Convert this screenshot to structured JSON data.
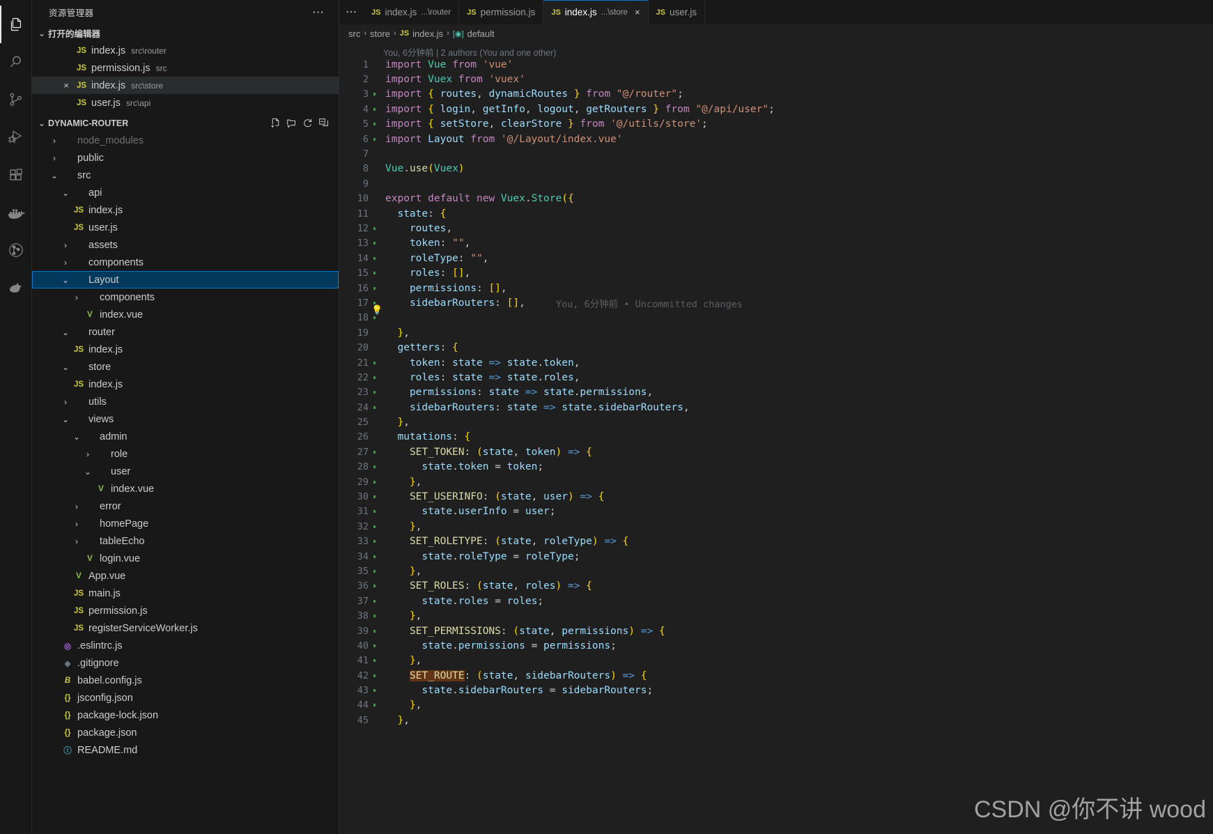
{
  "activity_bar": {
    "items": [
      {
        "name": "explorer",
        "icon": "files-icon",
        "active": true
      },
      {
        "name": "search",
        "icon": "search-icon",
        "active": false
      },
      {
        "name": "source-control",
        "icon": "source-control-icon",
        "active": false
      },
      {
        "name": "run-and-debug",
        "icon": "run-debug-icon",
        "active": false
      },
      {
        "name": "extensions",
        "icon": "extensions-icon",
        "active": false
      },
      {
        "name": "docker",
        "icon": "docker-icon",
        "active": false
      },
      {
        "name": "gitlens",
        "icon": "gitlens-icon",
        "active": false
      },
      {
        "name": "todo-tree",
        "icon": "todo-tree-icon",
        "active": false
      }
    ]
  },
  "sidebar": {
    "title": "资源管理器",
    "more_label": "⋯",
    "open_editors": {
      "label": "打开的编辑器",
      "twisty": "⌄",
      "items": [
        {
          "icon": "js-file-icon",
          "icon_text": "JS",
          "name": "index.js",
          "desc": "src\\router",
          "active": false,
          "close": ""
        },
        {
          "icon": "js-file-icon",
          "icon_text": "JS",
          "name": "permission.js",
          "desc": "src",
          "active": false,
          "close": ""
        },
        {
          "icon": "js-file-icon",
          "icon_text": "JS",
          "name": "index.js",
          "desc": "src\\store",
          "active": true,
          "close": "×"
        },
        {
          "icon": "js-file-icon",
          "icon_text": "JS",
          "name": "user.js",
          "desc": "src\\api",
          "active": false,
          "close": ""
        }
      ]
    },
    "project": {
      "label": "DYNAMIC-ROUTER",
      "twisty": "⌄",
      "actions": [
        "new-file-icon",
        "new-folder-icon",
        "refresh-icon",
        "collapse-all-icon"
      ],
      "tree": [
        {
          "indent": 1,
          "twisty": "›",
          "kind": "folder",
          "name": "node_modules",
          "dim": true
        },
        {
          "indent": 1,
          "twisty": "›",
          "kind": "folder",
          "name": "public",
          "dim": false
        },
        {
          "indent": 1,
          "twisty": "⌄",
          "kind": "folder",
          "name": "src",
          "dim": false
        },
        {
          "indent": 2,
          "twisty": "⌄",
          "kind": "folder",
          "name": "api",
          "dim": false
        },
        {
          "indent": 2,
          "twisty": "",
          "kind": "js",
          "icon_text": "JS",
          "name": "index.js",
          "dim": false
        },
        {
          "indent": 2,
          "twisty": "",
          "kind": "js",
          "icon_text": "JS",
          "name": "user.js",
          "dim": false
        },
        {
          "indent": 2,
          "twisty": "›",
          "kind": "folder",
          "name": "assets",
          "dim": false
        },
        {
          "indent": 2,
          "twisty": "›",
          "kind": "folder",
          "name": "components",
          "dim": false
        },
        {
          "indent": 2,
          "twisty": "⌄",
          "kind": "folder",
          "name": "Layout",
          "dim": false,
          "selected": true
        },
        {
          "indent": 3,
          "twisty": "›",
          "kind": "folder",
          "name": "components",
          "dim": false
        },
        {
          "indent": 3,
          "twisty": "",
          "kind": "vue",
          "icon_text": "V",
          "name": "index.vue",
          "dim": false
        },
        {
          "indent": 2,
          "twisty": "⌄",
          "kind": "folder",
          "name": "router",
          "dim": false
        },
        {
          "indent": 2,
          "twisty": "",
          "kind": "js",
          "icon_text": "JS",
          "name": "index.js",
          "dim": false
        },
        {
          "indent": 2,
          "twisty": "⌄",
          "kind": "folder",
          "name": "store",
          "dim": false
        },
        {
          "indent": 2,
          "twisty": "",
          "kind": "js",
          "icon_text": "JS",
          "name": "index.js",
          "dim": false
        },
        {
          "indent": 2,
          "twisty": "›",
          "kind": "folder",
          "name": "utils",
          "dim": false
        },
        {
          "indent": 2,
          "twisty": "⌄",
          "kind": "folder",
          "name": "views",
          "dim": false
        },
        {
          "indent": 3,
          "twisty": "⌄",
          "kind": "folder",
          "name": "admin",
          "dim": false
        },
        {
          "indent": 4,
          "twisty": "›",
          "kind": "folder",
          "name": "role",
          "dim": false
        },
        {
          "indent": 4,
          "twisty": "⌄",
          "kind": "folder",
          "name": "user",
          "dim": false
        },
        {
          "indent": 4,
          "twisty": "",
          "kind": "vue",
          "icon_text": "V",
          "name": "index.vue",
          "dim": false
        },
        {
          "indent": 3,
          "twisty": "›",
          "kind": "folder",
          "name": "error",
          "dim": false
        },
        {
          "indent": 3,
          "twisty": "›",
          "kind": "folder",
          "name": "homePage",
          "dim": false
        },
        {
          "indent": 3,
          "twisty": "›",
          "kind": "folder",
          "name": "tableEcho",
          "dim": false
        },
        {
          "indent": 3,
          "twisty": "",
          "kind": "vue",
          "icon_text": "V",
          "name": "login.vue",
          "dim": false
        },
        {
          "indent": 2,
          "twisty": "",
          "kind": "vue",
          "icon_text": "V",
          "name": "App.vue",
          "dim": false
        },
        {
          "indent": 2,
          "twisty": "",
          "kind": "js",
          "icon_text": "JS",
          "name": "main.js",
          "dim": false
        },
        {
          "indent": 2,
          "twisty": "",
          "kind": "js",
          "icon_text": "JS",
          "name": "permission.js",
          "dim": false
        },
        {
          "indent": 2,
          "twisty": "",
          "kind": "js",
          "icon_text": "JS",
          "name": "registerServiceWorker.js",
          "dim": false
        },
        {
          "indent": 1,
          "twisty": "",
          "kind": "eslint",
          "icon_text": "◎",
          "name": ".eslintrc.js",
          "dim": false
        },
        {
          "indent": 1,
          "twisty": "",
          "kind": "git",
          "icon_text": "◈",
          "name": ".gitignore",
          "dim": false
        },
        {
          "indent": 1,
          "twisty": "",
          "kind": "babel",
          "icon_text": "B",
          "name": "babel.config.js",
          "dim": false
        },
        {
          "indent": 1,
          "twisty": "",
          "kind": "json",
          "icon_text": "{}",
          "name": "jsconfig.json",
          "dim": false
        },
        {
          "indent": 1,
          "twisty": "",
          "kind": "json",
          "icon_text": "{}",
          "name": "package-lock.json",
          "dim": false
        },
        {
          "indent": 1,
          "twisty": "",
          "kind": "json",
          "icon_text": "{}",
          "name": "package.json",
          "dim": false
        },
        {
          "indent": 1,
          "twisty": "",
          "kind": "md",
          "icon_text": "ⓘ",
          "name": "README.md",
          "dim": false
        }
      ]
    }
  },
  "editor": {
    "more_label": "⋯",
    "tabs": [
      {
        "icon_text": "JS",
        "label": "index.js",
        "desc": "...\\router",
        "active": false,
        "close": ""
      },
      {
        "icon_text": "JS",
        "label": "permission.js",
        "desc": "",
        "active": false,
        "close": ""
      },
      {
        "icon_text": "JS",
        "label": "index.js",
        "desc": "...\\store",
        "active": true,
        "close": "×"
      },
      {
        "icon_text": "JS",
        "label": "user.js",
        "desc": "",
        "active": false,
        "close": ""
      }
    ],
    "breadcrumb": {
      "parts": [
        "src",
        "store",
        "index.js",
        "default"
      ],
      "separator": "›"
    },
    "blame_header": "You, 6分钟前 | 2 authors (You and one other)",
    "inline_blame": "You, 6分钟前 • Uncommitted changes",
    "lamp_icon": "lightbulb-icon",
    "lines": [
      {
        "n": 1,
        "dirty": false
      },
      {
        "n": 2,
        "dirty": false
      },
      {
        "n": 3,
        "dirty": true
      },
      {
        "n": 4,
        "dirty": true
      },
      {
        "n": 5,
        "dirty": true
      },
      {
        "n": 6,
        "dirty": true
      },
      {
        "n": 7,
        "dirty": false
      },
      {
        "n": 8,
        "dirty": false
      },
      {
        "n": 9,
        "dirty": false
      },
      {
        "n": 10,
        "dirty": false
      },
      {
        "n": 11,
        "dirty": false
      },
      {
        "n": 12,
        "dirty": true
      },
      {
        "n": 13,
        "dirty": true
      },
      {
        "n": 14,
        "dirty": true
      },
      {
        "n": 15,
        "dirty": true
      },
      {
        "n": 16,
        "dirty": true
      },
      {
        "n": 17,
        "dirty": true,
        "lamp": true
      },
      {
        "n": 18,
        "dirty": true
      },
      {
        "n": 19,
        "dirty": false
      },
      {
        "n": 20,
        "dirty": false
      },
      {
        "n": 21,
        "dirty": true
      },
      {
        "n": 22,
        "dirty": true
      },
      {
        "n": 23,
        "dirty": true
      },
      {
        "n": 24,
        "dirty": true
      },
      {
        "n": 25,
        "dirty": false
      },
      {
        "n": 26,
        "dirty": false
      },
      {
        "n": 27,
        "dirty": true
      },
      {
        "n": 28,
        "dirty": true
      },
      {
        "n": 29,
        "dirty": true
      },
      {
        "n": 30,
        "dirty": true
      },
      {
        "n": 31,
        "dirty": true
      },
      {
        "n": 32,
        "dirty": true
      },
      {
        "n": 33,
        "dirty": true
      },
      {
        "n": 34,
        "dirty": true
      },
      {
        "n": 35,
        "dirty": true
      },
      {
        "n": 36,
        "dirty": true
      },
      {
        "n": 37,
        "dirty": true
      },
      {
        "n": 38,
        "dirty": true
      },
      {
        "n": 39,
        "dirty": true
      },
      {
        "n": 40,
        "dirty": true
      },
      {
        "n": 41,
        "dirty": true
      },
      {
        "n": 42,
        "dirty": true
      },
      {
        "n": 43,
        "dirty": true
      },
      {
        "n": 44,
        "dirty": true
      },
      {
        "n": 45,
        "dirty": false
      }
    ],
    "source_lines": [
      "import Vue from 'vue'",
      "import Vuex from 'vuex'",
      "import { routes, dynamicRoutes } from \"@/router\";",
      "import { login, getInfo, logout, getRouters } from \"@/api/user\";",
      "import { setStore, clearStore } from '@/utils/store';",
      "import Layout from '@/Layout/index.vue'",
      "",
      "Vue.use(Vuex)",
      "",
      "export default new Vuex.Store({",
      "  state: {",
      "    routes,",
      "    token: \"\",",
      "    roleType: \"\",",
      "    roles: [],",
      "    permissions: [],",
      "    sidebarRouters: [],",
      "",
      "  },",
      "  getters: {",
      "    token: state => state.token,",
      "    roles: state => state.roles,",
      "    permissions: state => state.permissions,",
      "    sidebarRouters: state => state.sidebarRouters,",
      "  },",
      "  mutations: {",
      "    SET_TOKEN: (state, token) => {",
      "      state.token = token;",
      "    },",
      "    SET_USERINFO: (state, user) => {",
      "      state.userInfo = user;",
      "    },",
      "    SET_ROLETYPE: (state, roleType) => {",
      "      state.roleType = roleType;",
      "    },",
      "    SET_ROLES: (state, roles) => {",
      "      state.roles = roles;",
      "    },",
      "    SET_PERMISSIONS: (state, permissions) => {",
      "      state.permissions = permissions;",
      "    },",
      "    SET_ROUTE: (state, sidebarRouters) => {",
      "      state.sidebarRouters = sidebarRouters;",
      "    },",
      "  },"
    ]
  },
  "watermark": "CSDN @你不讲 wood",
  "colors": {
    "accent": "#0078d4",
    "selected_row": "#04395e",
    "dirty_gutter": "#4b8f4e",
    "selection_highlight": "#623315",
    "editor_bg": "#1f1f1f",
    "sidebar_bg": "#181818"
  }
}
